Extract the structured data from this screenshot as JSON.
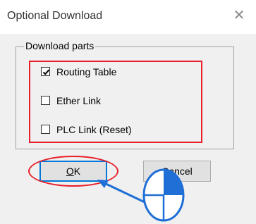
{
  "window": {
    "title": "Optional Download",
    "close_glyph": "✕"
  },
  "group": {
    "label": "Download parts",
    "options": [
      {
        "label": "Routing Table",
        "checked": true
      },
      {
        "label": "Ether Link",
        "checked": false
      },
      {
        "label": "PLC Link (Reset)",
        "checked": false
      }
    ]
  },
  "buttons": {
    "ok_mnemonic": "O",
    "ok_rest": "K",
    "cancel_mnemonic": "C",
    "cancel_rest": "ancel"
  },
  "colors": {
    "annotation_red": "#e8202b",
    "arrow_blue": "#1f6fd6",
    "focus_blue": "#0078d7"
  },
  "icons": {
    "close": "close-icon",
    "check": "check-icon",
    "cursor": "mouse-click-icon",
    "arrow": "arrow-icon"
  }
}
